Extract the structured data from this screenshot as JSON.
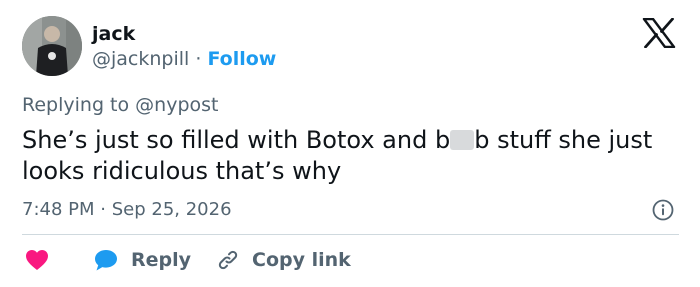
{
  "tweet": {
    "author_name": "jack",
    "author_handle": "@jacknpill",
    "separator": "·",
    "follow_label": "Follow",
    "replying_to_prefix": "Replying to",
    "replying_to_handle": "@nypost",
    "text_part1": "She’s just so filled with Botox and b",
    "text_part2": "b stuff she just looks ridiculous that’s why",
    "time": "7:48 PM",
    "date": "Sep 25, 2026"
  },
  "actions": {
    "reply_label": "Reply",
    "copy_link_label": "Copy link"
  },
  "icons": {
    "brand": "x-logo-icon",
    "info": "info-icon",
    "like": "heart-icon",
    "reply": "speech-bubble-icon",
    "copy": "link-icon"
  },
  "colors": {
    "text": "#0f1419",
    "muted": "#536471",
    "follow": "#1d9bf0",
    "heart": "#f91880",
    "reply_bubble": "#1d9bf0",
    "divider": "#cfd9de"
  }
}
